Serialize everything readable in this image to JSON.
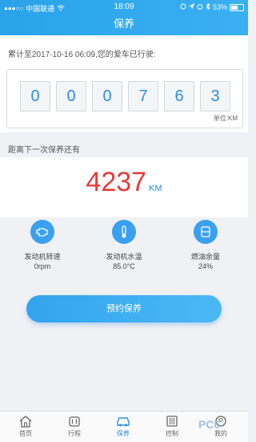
{
  "status_bar": {
    "carrier": "中国联通",
    "time": "18:09",
    "battery": "53%"
  },
  "nav": {
    "title": "保养"
  },
  "odometer": {
    "label": "累计至2017-10-16 06:09,您的爱车已行驶:",
    "digits": [
      "0",
      "0",
      "0",
      "7",
      "6",
      "3"
    ],
    "unit": "单位:KM"
  },
  "next_service": {
    "label": "距离下一次保养还有",
    "distance": "4237",
    "unit": "KM"
  },
  "gauges": [
    {
      "icon": "engine-icon",
      "label": "发动机转速",
      "value": "0rpm"
    },
    {
      "icon": "thermometer-icon",
      "label": "发动机水温",
      "value": "85.0°C"
    },
    {
      "icon": "fuel-tank-icon",
      "label": "燃油余量",
      "value": "24%"
    }
  ],
  "action": {
    "book_label": "预约保养"
  },
  "tabs": [
    {
      "icon": "home-icon",
      "label": "首页",
      "active": false
    },
    {
      "icon": "trip-icon",
      "label": "行程",
      "active": false
    },
    {
      "icon": "car-icon",
      "label": "保养",
      "active": true
    },
    {
      "icon": "control-icon",
      "label": "控制",
      "active": false
    },
    {
      "icon": "profile-icon",
      "label": "我的",
      "active": false
    }
  ],
  "colors": {
    "accent": "#2a8fe2",
    "distance": "#e53b3b",
    "header": "#2aa3ea"
  },
  "watermark": "PC6"
}
